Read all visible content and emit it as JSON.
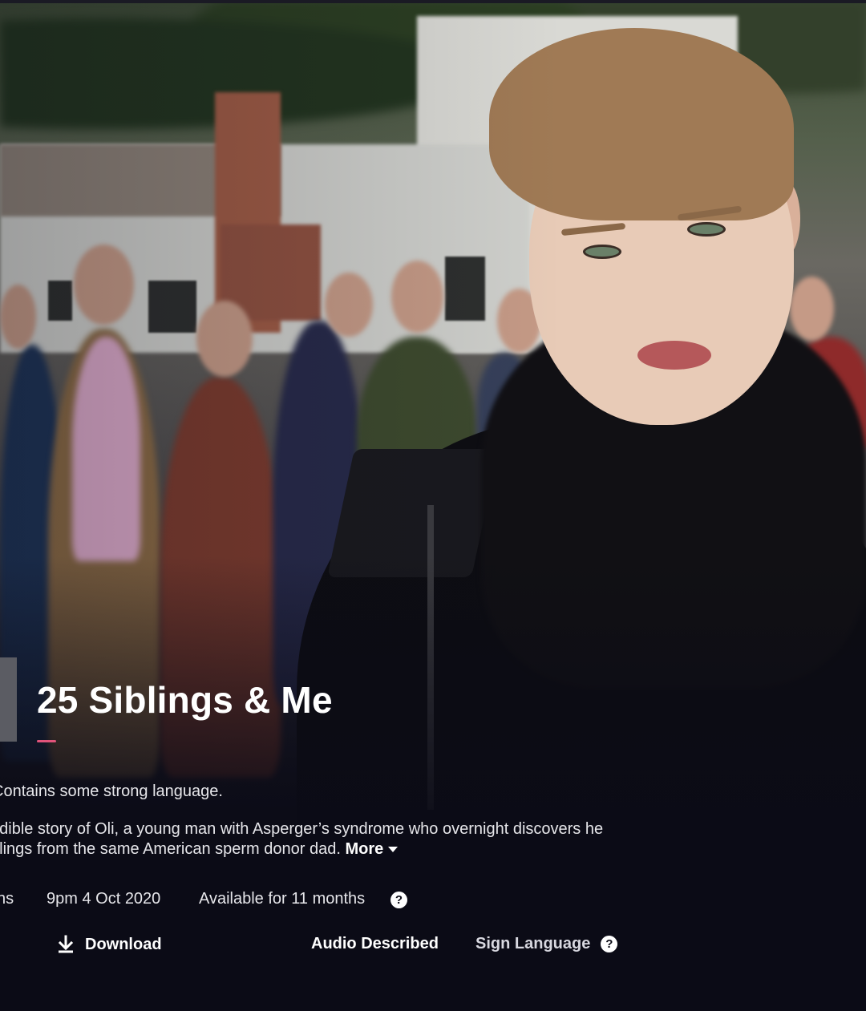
{
  "programme": {
    "title": "25 Siblings & Me",
    "guidance": "Contains some strong language.",
    "synopsis_lines": [
      "edible story of Oli, a young man with Asperger’s syndrome who overnight discovers he",
      "blings from the same American sperm donor dad."
    ],
    "more_label": "More",
    "meta": {
      "duration": "ns",
      "broadcast": "9pm 4 Oct 2020",
      "availability": "Available for 11 months"
    }
  },
  "actions": {
    "download_label": "Download",
    "audio_described_label": "Audio Described",
    "sign_language_label": "Sign Language"
  },
  "icons": {
    "help": "?",
    "download": "download-icon",
    "more": "chevron-down-icon"
  },
  "colors": {
    "accent": "#e0537a",
    "background": "#0b0b16",
    "text": "#ffffff"
  }
}
